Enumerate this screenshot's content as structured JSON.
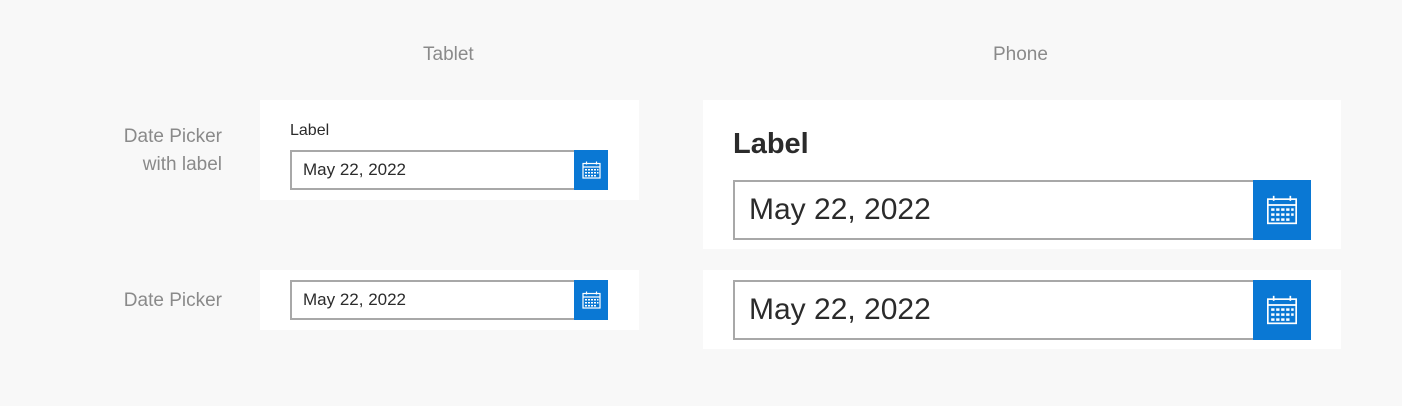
{
  "columns": {
    "tablet": "Tablet",
    "phone": "Phone"
  },
  "rows": {
    "with_label": {
      "line1": "Date Picker",
      "line2": "with label"
    },
    "plain": {
      "line1": "Date Picker"
    }
  },
  "tablet": {
    "labeled": {
      "label": "Label",
      "value": "May 22, 2022"
    },
    "plain": {
      "value": "May 22, 2022"
    }
  },
  "phone": {
    "labeled": {
      "label": "Label",
      "value": "May 22, 2022"
    },
    "plain": {
      "value": "May 22, 2022"
    }
  },
  "icons": {
    "calendar": "calendar-icon"
  },
  "colors": {
    "accent": "#0a78d4",
    "border": "#a8a8a8",
    "background": "#f8f8f8",
    "panel": "#ffffff"
  }
}
